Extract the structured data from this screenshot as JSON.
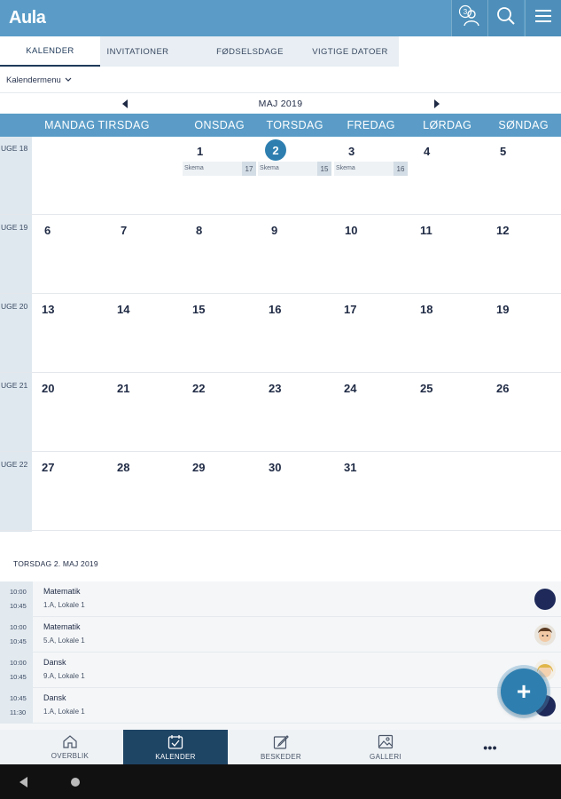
{
  "header": {
    "logo": "Aula",
    "notification_count": "3"
  },
  "tabs": [
    {
      "label": "KALENDER",
      "active": true
    },
    {
      "label": "INVITATIONER"
    },
    {
      "label": "FØDSELSDAGE"
    },
    {
      "label": "VIGTIGE DATOER"
    }
  ],
  "calendar_menu": "Kalendermenu",
  "month": "MAJ 2019",
  "day_names": [
    "MANDAG",
    "TIRSDAG",
    "ONSDAG",
    "TORSDAG",
    "FREDAG",
    "LØRDAG",
    "SØNDAG"
  ],
  "weeks": [
    {
      "label": "UGE 18",
      "days": [
        "",
        "",
        "1",
        "2",
        "3",
        "4",
        "5"
      ]
    },
    {
      "label": "UGE 19",
      "days": [
        "6",
        "7",
        "8",
        "9",
        "10",
        "11",
        "12"
      ]
    },
    {
      "label": "UGE 20",
      "days": [
        "13",
        "14",
        "15",
        "16",
        "17",
        "18",
        "19"
      ]
    },
    {
      "label": "UGE 21",
      "days": [
        "20",
        "21",
        "22",
        "23",
        "24",
        "25",
        "26"
      ]
    },
    {
      "label": "UGE 22",
      "days": [
        "27",
        "28",
        "29",
        "30",
        "31",
        "",
        ""
      ]
    }
  ],
  "today": "2",
  "events": [
    {
      "title": "Skema",
      "count": "17"
    },
    {
      "title": "Skema",
      "count": "15"
    },
    {
      "title": "Skema",
      "count": "16"
    }
  ],
  "selected_date": "TORSDAG 2. MAJ 2019",
  "agenda": [
    {
      "start": "10:00",
      "end": "10:45",
      "title": "Matematik",
      "location": "1.A, Lokale 1"
    },
    {
      "start": "10:00",
      "end": "10:45",
      "title": "Matematik",
      "location": "5.A, Lokale 1"
    },
    {
      "start": "10:00",
      "end": "10:45",
      "title": "Dansk",
      "location": "9.A, Lokale 1"
    },
    {
      "start": "10:45",
      "end": "11:30",
      "title": "Dansk",
      "location": "1.A, Lokale 1"
    }
  ],
  "fab_label": "+",
  "bottom_nav": [
    {
      "label": "OVERBLIK",
      "icon": "home-icon"
    },
    {
      "label": "KALENDER",
      "icon": "calendar-icon",
      "active": true
    },
    {
      "label": "BESKEDER",
      "icon": "compose-icon"
    },
    {
      "label": "GALLERI",
      "icon": "gallery-icon"
    },
    {
      "label": "•••",
      "icon": "more-icon"
    }
  ],
  "colors": {
    "primary": "#5a9cc7",
    "accent": "#2e7fb0",
    "nav_active": "#1f4565"
  }
}
